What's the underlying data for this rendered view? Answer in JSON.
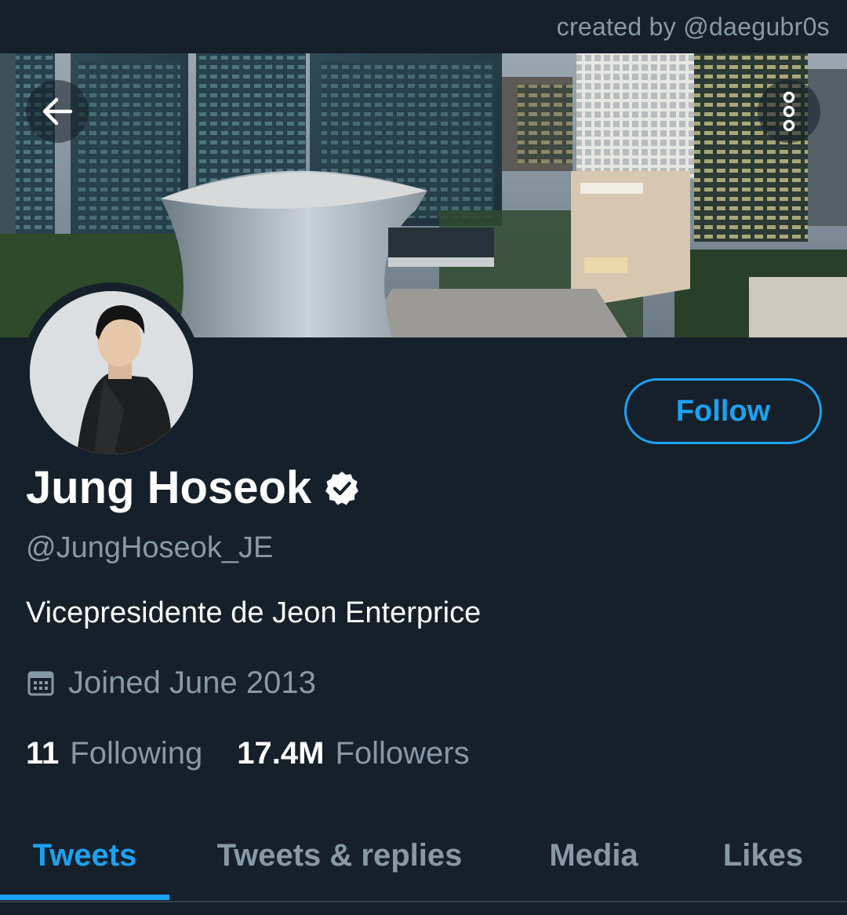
{
  "watermark": {
    "text": "created by @daegubr0s"
  },
  "header": {
    "back_icon": "arrow-left-icon",
    "more_icon": "more-vertical-icon"
  },
  "profile": {
    "display_name": "Jung Hoseok",
    "verified": true,
    "handle": "@JungHoseok_JE",
    "bio": "Vicepresidente de Jeon Enterprice",
    "joined": "Joined June 2013",
    "follow_label": "Follow",
    "following_count": "11",
    "following_label": "Following",
    "followers_count": "17.4M",
    "followers_label": "Followers"
  },
  "tabs": [
    {
      "label": "Tweets",
      "active": true
    },
    {
      "label": "Tweets & replies",
      "active": false
    },
    {
      "label": "Media",
      "active": false
    },
    {
      "label": "Likes",
      "active": false
    }
  ],
  "colors": {
    "background": "#15202b",
    "accent": "#1da1f2",
    "secondary_text": "#8899a6",
    "divider": "#38444d"
  }
}
